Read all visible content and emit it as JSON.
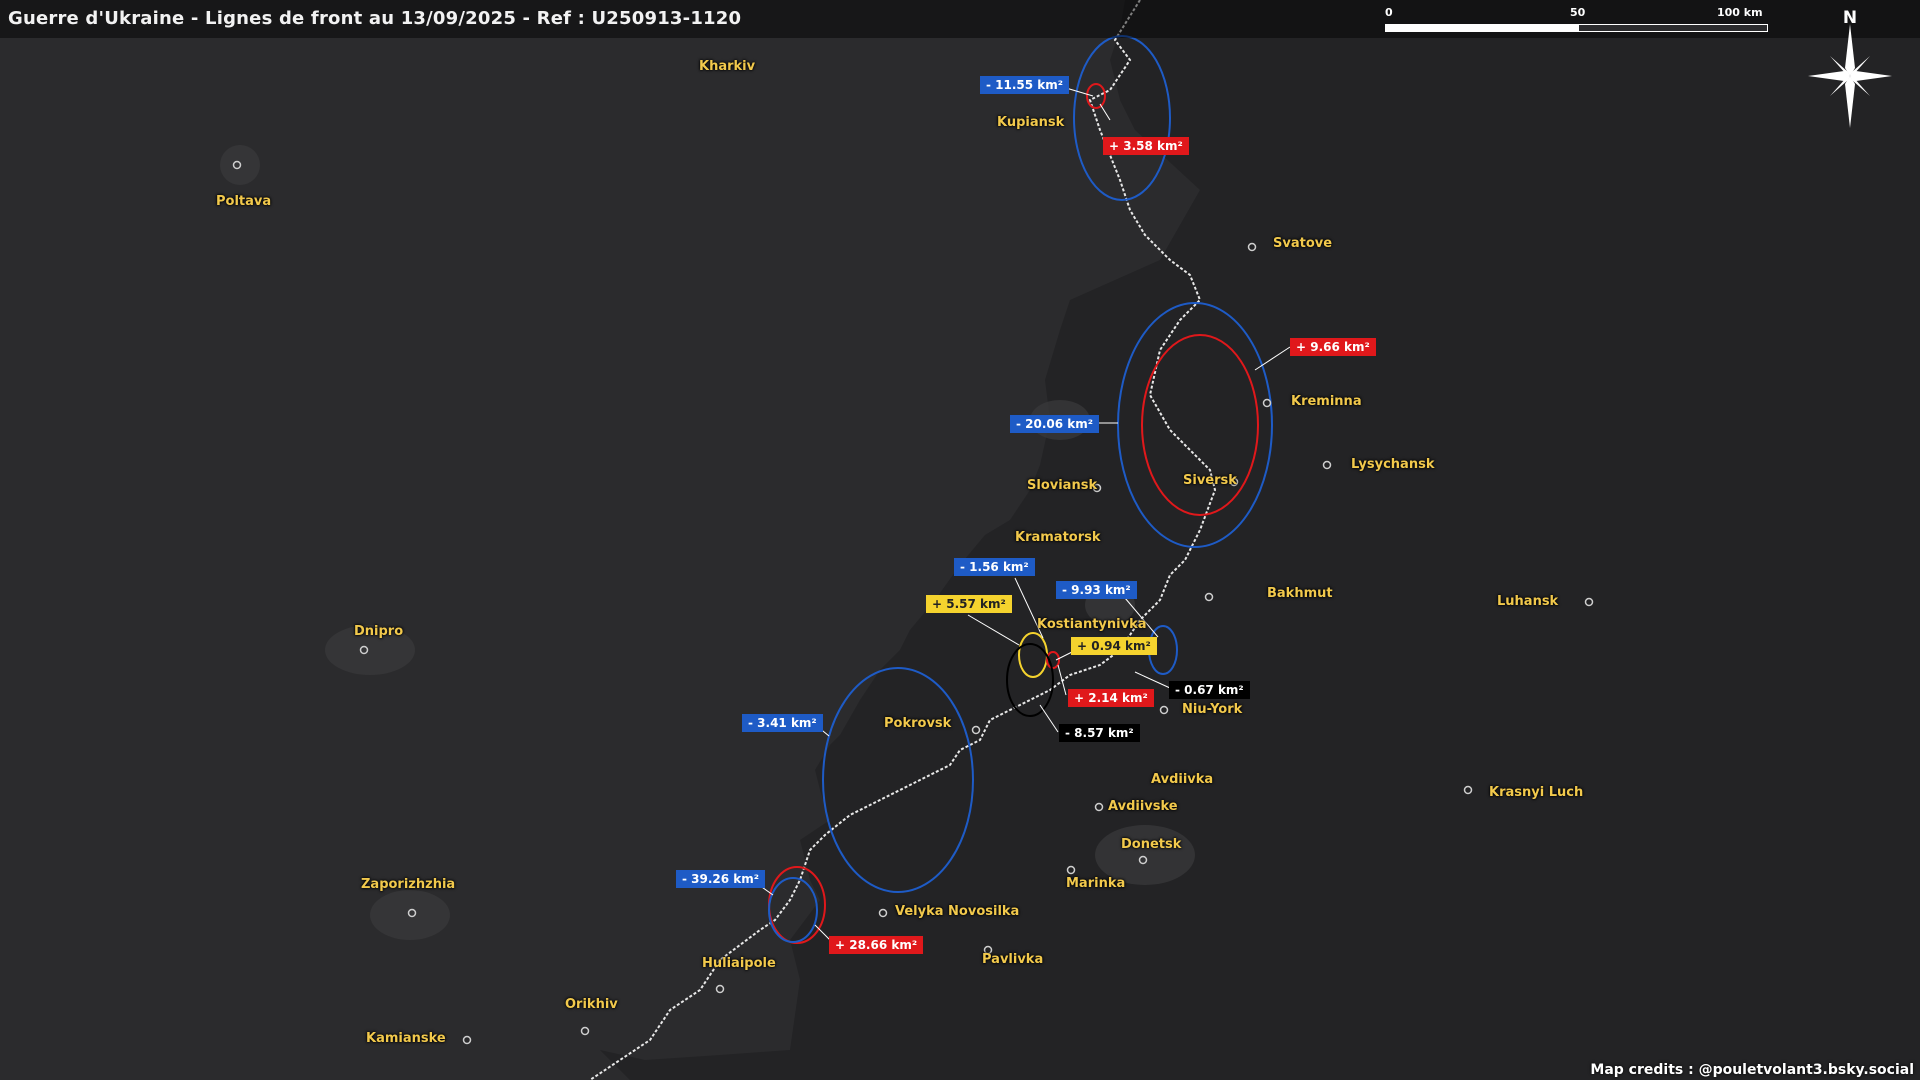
{
  "title": "Guerre d'Ukraine - Lignes de front au 13/09/2025 - Ref : U250913-1120",
  "scale_bar": {
    "labels": [
      "0",
      "50",
      "100 km"
    ]
  },
  "north_label": "N",
  "credits": "Map credits : @pouletvolant3.bsky.social",
  "cities": [
    {
      "name": "Kharkiv"
    },
    {
      "name": "Poltava"
    },
    {
      "name": "Kupiansk"
    },
    {
      "name": "Svatove"
    },
    {
      "name": "Kreminna"
    },
    {
      "name": "Lysychansk"
    },
    {
      "name": "Siversk"
    },
    {
      "name": "Sloviansk"
    },
    {
      "name": "Kramatorsk"
    },
    {
      "name": "Bakhmut"
    },
    {
      "name": "Kostiantynivka"
    },
    {
      "name": "Luhansk"
    },
    {
      "name": "Dnipro"
    },
    {
      "name": "Niu-York"
    },
    {
      "name": "Pokrovsk"
    },
    {
      "name": "Avdiivka"
    },
    {
      "name": "Avdiivske"
    },
    {
      "name": "Krasnyi Luch"
    },
    {
      "name": "Donetsk"
    },
    {
      "name": "Marinka"
    },
    {
      "name": "Zaporizhzhia"
    },
    {
      "name": "Velyka Novosilka"
    },
    {
      "name": "Pavlivka"
    },
    {
      "name": "Huliaipole"
    },
    {
      "name": "Orikhiv"
    },
    {
      "name": "Kamianske"
    }
  ],
  "changes": [
    {
      "label": "- 11.55 km²",
      "type": "loss"
    },
    {
      "label": "+ 3.58 km²",
      "type": "gain"
    },
    {
      "label": "+ 9.66 km²",
      "type": "gain"
    },
    {
      "label": "- 20.06 km²",
      "type": "loss"
    },
    {
      "label": "- 1.56 km²",
      "type": "loss"
    },
    {
      "label": "- 9.93 km²",
      "type": "loss"
    },
    {
      "label": "+ 5.57 km²",
      "type": "contested"
    },
    {
      "label": "+ 0.94 km²",
      "type": "contested"
    },
    {
      "label": "- 0.67 km²",
      "type": "neutral"
    },
    {
      "label": "+ 2.14 km²",
      "type": "gain"
    },
    {
      "label": "- 8.57 km²",
      "type": "neutral"
    },
    {
      "label": "- 3.41 km²",
      "type": "loss"
    },
    {
      "label": "- 39.26 km²",
      "type": "loss"
    },
    {
      "label": "+ 28.66 km²",
      "type": "gain"
    }
  ],
  "colors": {
    "background": "#2b2b2d",
    "occupied": "#232325",
    "city": "#f2c94c",
    "loss": "#1e5bc6",
    "gain": "#e0181b",
    "contested": "#f5d32e",
    "neutral": "#000000"
  }
}
